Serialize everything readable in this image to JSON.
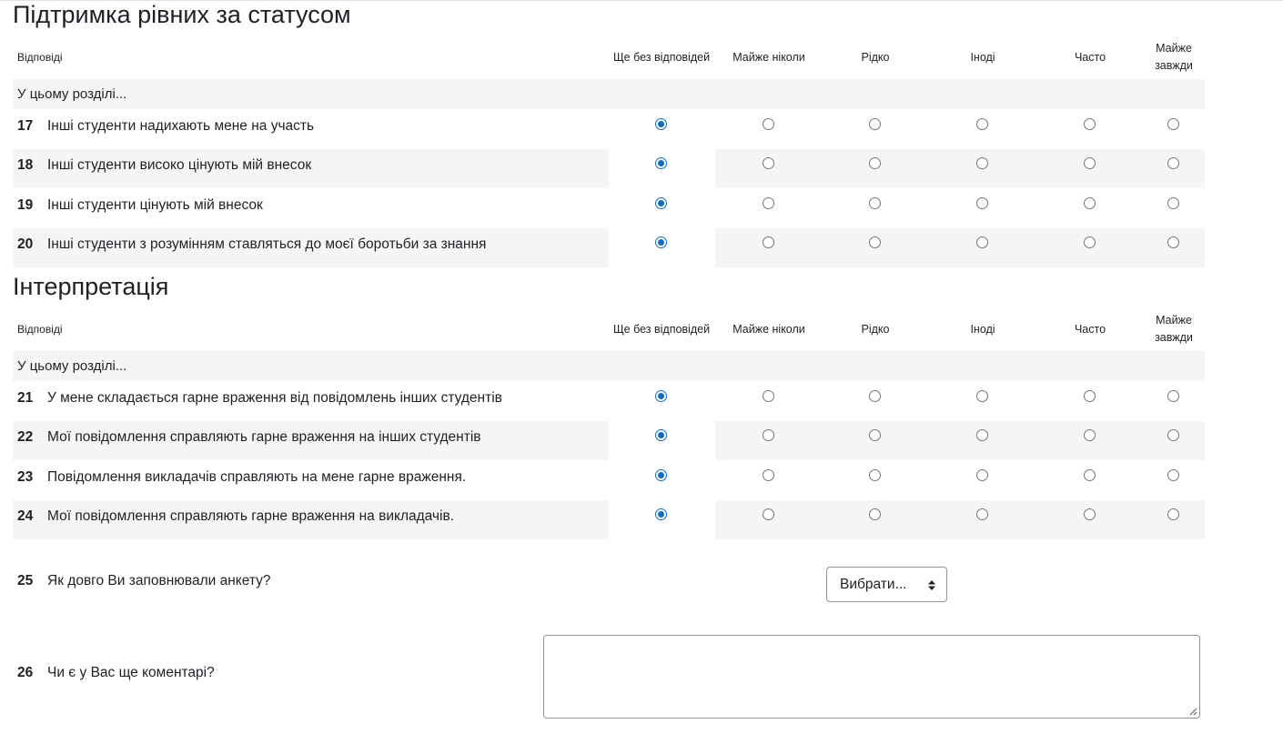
{
  "sections": [
    {
      "title": "Підтримка рівних за статусом",
      "header_label": "Відповіді",
      "subheading": "У цьому розділі...",
      "questions": [
        {
          "number": "17",
          "text": "Інші студенти надихають мене на участь",
          "selected": 0
        },
        {
          "number": "18",
          "text": "Інші студенти високо цінують мій внесок",
          "selected": 0
        },
        {
          "number": "19",
          "text": "Інші студенти цінують мій внесок",
          "selected": 0
        },
        {
          "number": "20",
          "text": "Інші студенти з розумінням ставляться до моєї боротьби за знання",
          "selected": 0
        }
      ]
    },
    {
      "title": "Інтерпретація",
      "header_label": "Відповіді",
      "subheading": "У цьому розділі...",
      "questions": [
        {
          "number": "21",
          "text": "У мене складається гарне враження від повідомлень інших студентів",
          "selected": 0
        },
        {
          "number": "22",
          "text": "Мої повідомлення справляють гарне враження на інших студентів",
          "selected": 0
        },
        {
          "number": "23",
          "text": "Повідомлення викладачів справляють на мене гарне враження.",
          "selected": 0
        },
        {
          "number": "24",
          "text": "Мої повідомлення справляють гарне враження на викладачів.",
          "selected": 0
        }
      ]
    }
  ],
  "options": [
    "Ще без відповідей",
    "Майже ніколи",
    "Рідко",
    "Іноді",
    "Часто",
    "Майже завжди"
  ],
  "q25": {
    "number": "25",
    "text": "Як довго Ви заповнювали анкету?",
    "select_value": "Вибрати..."
  },
  "q26": {
    "number": "26",
    "text": "Чи є у Вас ще коментарі?",
    "value": ""
  },
  "colors": {
    "accent": "#0f6cbf",
    "row_alt": "#f5f5f5",
    "border": "#8f959e"
  },
  "icons": {
    "select_caret": "sort-caret-icon",
    "resize": "resize-grip-icon"
  }
}
